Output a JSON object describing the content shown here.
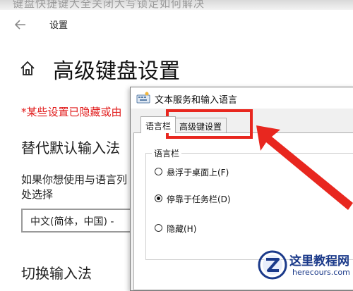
{
  "top_banner": {
    "text": "键盘快捷键大全关闭大写锁定如何解决"
  },
  "settings": {
    "window_title": "设置",
    "page_title": "高级键盘设置",
    "warning": "*某些设置已隐藏或由",
    "section_default_input": "替代默认输入法",
    "para_line1": "如果你想使用与语言列",
    "para_line2": "处选择",
    "selected_input_method": "中文(简体，中国) -",
    "section_switch": "切换输入法"
  },
  "dialog": {
    "title": "文本服务和输入语言",
    "tabs": [
      {
        "label": "语言栏",
        "active": true
      },
      {
        "label": "高级键设置",
        "active": false
      }
    ],
    "group_label": "语言栏",
    "options": [
      {
        "label": "悬浮于桌面上(F)",
        "checked": false
      },
      {
        "label": "停靠于任务栏(D)",
        "checked": true
      },
      {
        "label": "隐藏(H)",
        "checked": false
      }
    ]
  },
  "annotation": {
    "color": "#e8271f"
  },
  "watermark": {
    "name": "这里教程网",
    "url": "herecours.com"
  },
  "icons": {
    "back": "back-arrow-icon",
    "home": "home-icon",
    "dialog": "keyboard-icon"
  }
}
